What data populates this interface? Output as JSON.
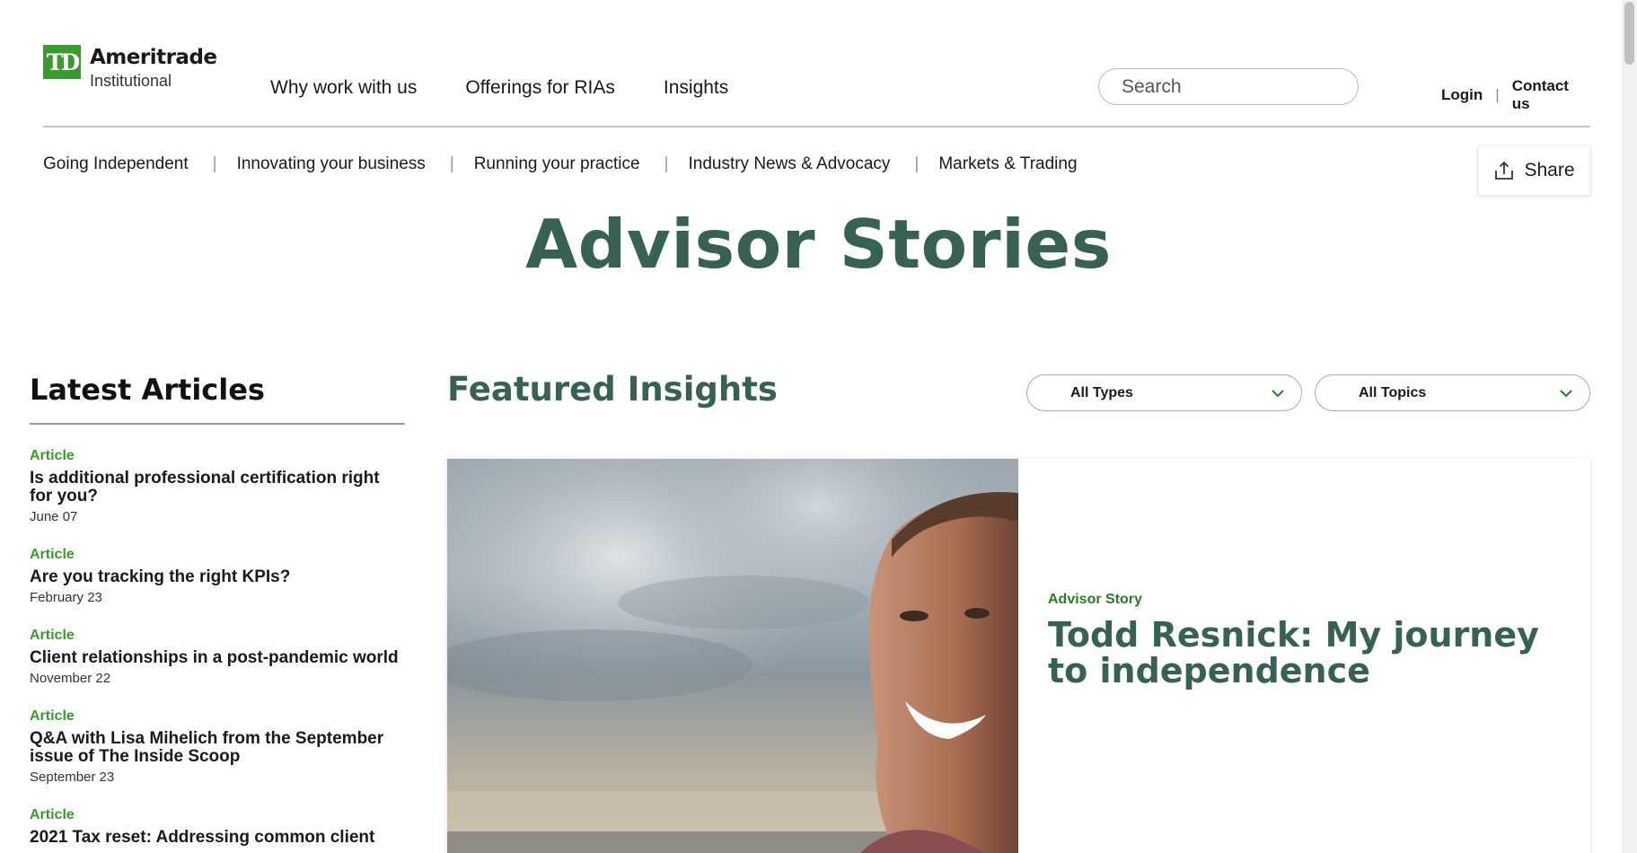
{
  "brand": {
    "logo_mark": "TD",
    "name": "Ameritrade",
    "sub": "Institutional",
    "accent_color": "#3a9a2e",
    "heading_color": "#376155"
  },
  "main_nav": [
    "Why work with us",
    "Offerings for RIAs",
    "Insights"
  ],
  "search": {
    "placeholder": "Search",
    "icon": "search-icon"
  },
  "util_nav": {
    "login": "Login",
    "contact": "Contact us"
  },
  "sub_nav": [
    "Going Independent",
    "Innovating your business",
    "Running your practice",
    "Industry News & Advocacy",
    "Markets & Trading"
  ],
  "share": {
    "label": "Share",
    "icon": "share-icon"
  },
  "page_title": "Advisor Stories",
  "latest": {
    "title": "Latest Articles",
    "articles": [
      {
        "type": "Article",
        "title": "Is additional professional certification right for you?",
        "date": "June 07"
      },
      {
        "type": "Article",
        "title": "Are you tracking the right KPIs?",
        "date": "February 23"
      },
      {
        "type": "Article",
        "title": "Client relationships in a post-pandemic world",
        "date": "November 22"
      },
      {
        "type": "Article",
        "title": "Q&A with Lisa Mihelich from the September issue of The Inside Scoop",
        "date": "September 23"
      },
      {
        "type": "Article",
        "title": "2021 Tax reset: Addressing common client",
        "date": ""
      }
    ]
  },
  "featured": {
    "title": "Featured Insights",
    "filters": {
      "types": "All Types",
      "topics": "All Topics"
    },
    "card": {
      "type": "Advisor Story",
      "title": "Todd Resnick: My journey to independence",
      "image": "smiling man photo against cloudy sky"
    }
  }
}
